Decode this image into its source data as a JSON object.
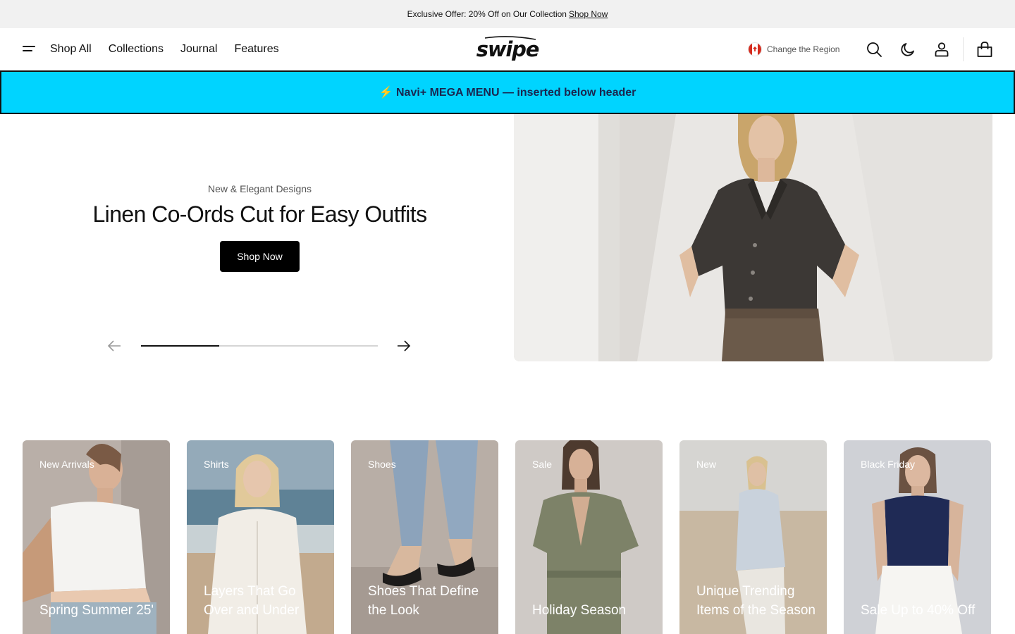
{
  "announcement": {
    "text": "Exclusive Offer: 20% Off on Our Collection",
    "link": "Shop Now"
  },
  "header": {
    "nav": [
      "Shop All",
      "Collections",
      "Journal",
      "Features"
    ],
    "logo": "swipe",
    "region_label": "Change the Region",
    "icons": [
      "menu-icon",
      "canada-flag-icon",
      "search-icon",
      "moon-icon",
      "account-icon",
      "bag-icon"
    ]
  },
  "mega_banner": {
    "text": "⚡ Navi+ MEGA MENU — inserted below header",
    "bg_color": "#00d4ff"
  },
  "hero": {
    "eyebrow": "New & Elegant Designs",
    "title": "Linen Co-Ords Cut for Easy Outfits",
    "button": "Shop Now",
    "slider_progress": 0.33
  },
  "categories": [
    {
      "tag": "New Arrivals",
      "title": "Spring Summer 25'"
    },
    {
      "tag": "Shirts",
      "title": "Layers That Go Over and Under"
    },
    {
      "tag": "Shoes",
      "title": "Shoes That Define the Look"
    },
    {
      "tag": "Sale",
      "title": "Holiday Season"
    },
    {
      "tag": "New",
      "title": "Unique Trending Items of the Season"
    },
    {
      "tag": "Black Friday",
      "title": "Sale Up to 40% Off"
    }
  ]
}
